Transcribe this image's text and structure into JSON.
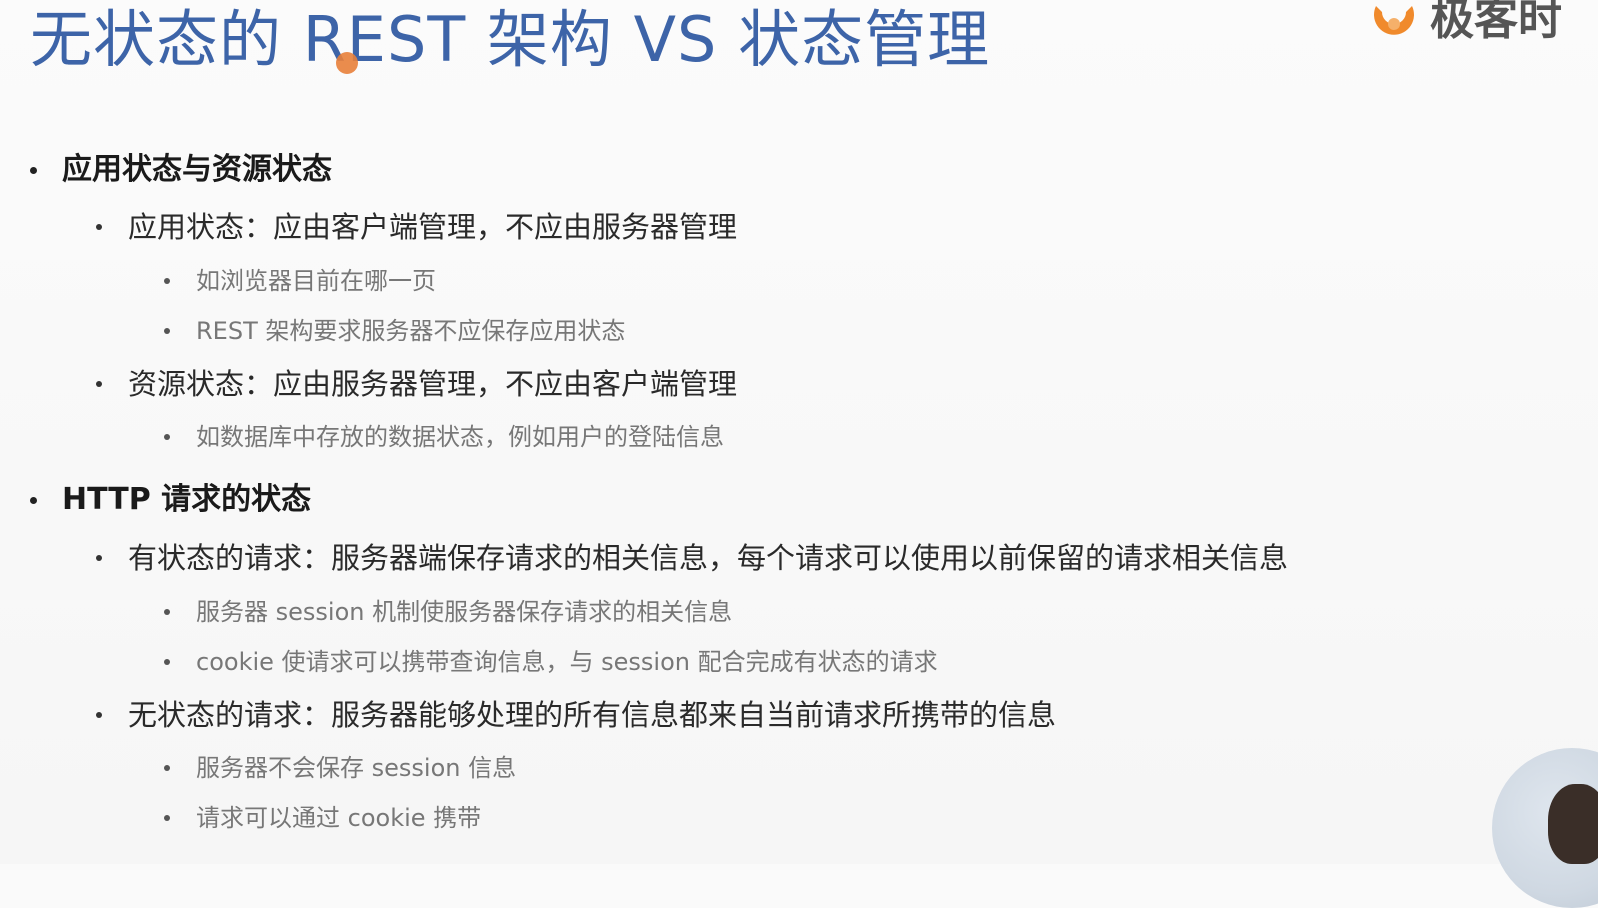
{
  "slide": {
    "title": "无状态的 REST 架构 VS 状态管理",
    "logo_text": "极客时",
    "logo_icon": "geek-time-logo-icon",
    "title_color": "#3d64a8",
    "accent_color": "#e8803a"
  },
  "content": {
    "s1": {
      "heading": "应用状态与资源状态",
      "app": {
        "text": "应用状态：应由客户端管理，不应由服务器管理",
        "subs": [
          "如浏览器目前在哪一页",
          "REST 架构要求服务器不应保存应用状态"
        ]
      },
      "res": {
        "text": "资源状态：应由服务器管理，不应由客户端管理",
        "subs": [
          "如数据库中存放的数据状态，例如用户的登陆信息"
        ]
      }
    },
    "s2": {
      "heading": "HTTP 请求的状态",
      "stateful": {
        "text": "有状态的请求：服务器端保存请求的相关信息，每个请求可以使用以前保留的请求相关信息",
        "subs": [
          "服务器 session 机制使服务器保存请求的相关信息",
          "cookie 使请求可以携带查询信息，与 session 配合完成有状态的请求"
        ]
      },
      "stateless": {
        "text": "无状态的请求：服务器能够处理的所有信息都来自当前请求所携带的信息",
        "subs": [
          "服务器不会保存 session 信息",
          "请求可以通过 cookie 携带"
        ]
      }
    }
  }
}
